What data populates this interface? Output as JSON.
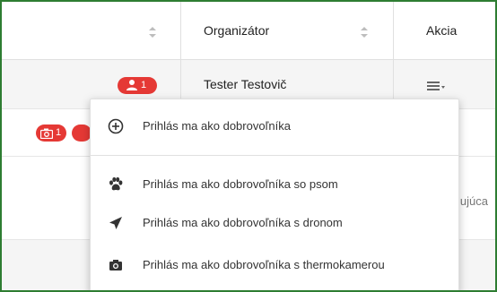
{
  "table": {
    "headers": {
      "organizer": "Organizátor",
      "action": "Akcia"
    },
    "row1": {
      "badge_count": "1",
      "organizer": "Tester Testovič"
    },
    "row2": {
      "badge_camera_count": "1"
    },
    "row3": {
      "partial_text": "lujúca"
    }
  },
  "menu": {
    "items": [
      {
        "label": "Prihlás ma ako dobrovoľníka",
        "icon": "plus-circle-icon"
      },
      {
        "label": "Prihlás ma ako dobrovoľníka so psom",
        "icon": "paw-icon"
      },
      {
        "label": "Prihlás ma ako dobrovoľníka s dronom",
        "icon": "paper-plane-icon"
      },
      {
        "label": "Prihlás ma ako dobrovoľníka s thermokamerou",
        "icon": "camera-icon"
      }
    ]
  },
  "colors": {
    "frame_border": "#2e7d32",
    "badge": "#e53935"
  }
}
